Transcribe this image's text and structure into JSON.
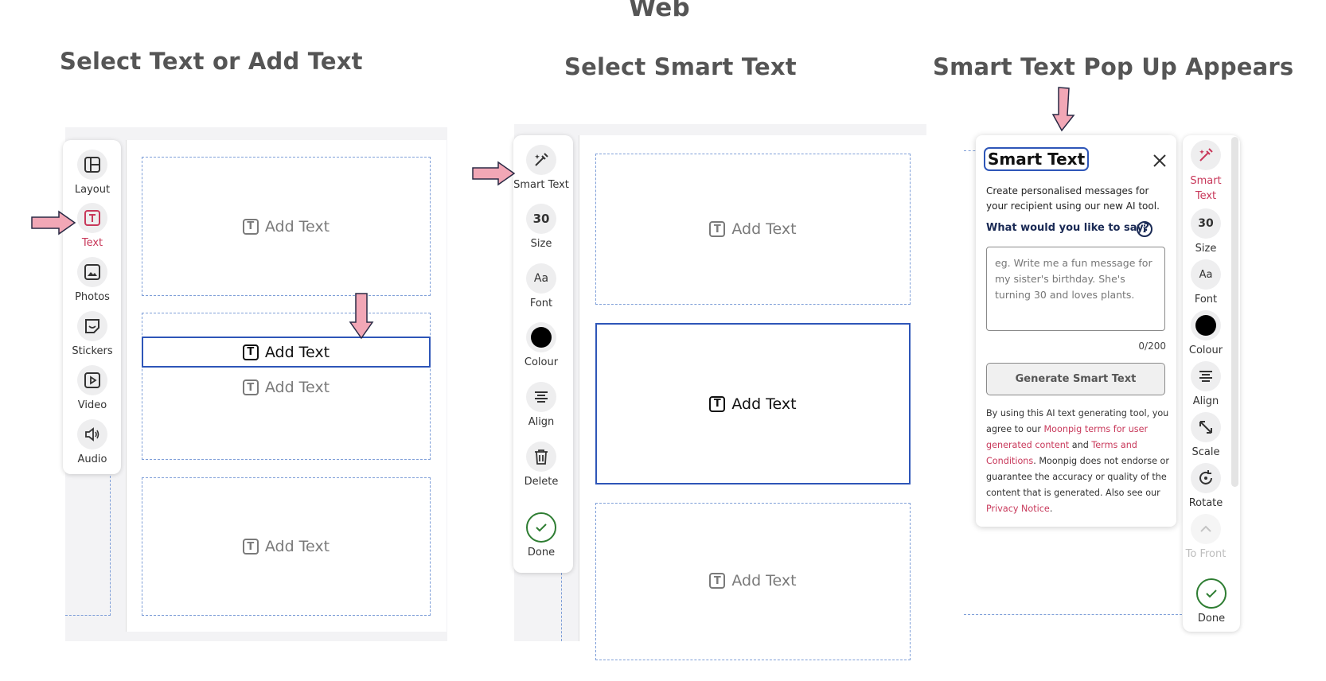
{
  "page_title": "Web",
  "steps": [
    {
      "heading": "Select Text or Add Text"
    },
    {
      "heading": "Select Smart Text"
    },
    {
      "heading": "Smart Text Pop Up Appears"
    }
  ],
  "panel1": {
    "tools": [
      {
        "label": "Layout",
        "icon": "layout-icon"
      },
      {
        "label": "Text",
        "icon": "text-icon",
        "active": true
      },
      {
        "label": "Photos",
        "icon": "photo-icon"
      },
      {
        "label": "Stickers",
        "icon": "sticker-icon"
      },
      {
        "label": "Video",
        "icon": "video-icon"
      },
      {
        "label": "Audio",
        "icon": "audio-icon"
      }
    ],
    "boxes": [
      "Add Text",
      "Add Text",
      "Add Text",
      "Add Text"
    ]
  },
  "panel2": {
    "tools": [
      {
        "label": "Smart Text",
        "icon": "magic-wand-icon"
      },
      {
        "label": "Size",
        "value": "30"
      },
      {
        "label": "Font",
        "glyph": "Aa"
      },
      {
        "label": "Colour",
        "icon": "colour-swatch-icon",
        "color": "#000000"
      },
      {
        "label": "Align",
        "icon": "align-icon"
      },
      {
        "label": "Delete",
        "icon": "trash-icon"
      },
      {
        "label": "Done",
        "icon": "check-icon"
      }
    ],
    "boxes": [
      "Add Text",
      "Add Text",
      "Add Text"
    ]
  },
  "panel3": {
    "popup": {
      "title": "Smart Text",
      "description": "Create personalised messages for your recipient using our new AI tool.",
      "question": "What would you like to say?",
      "placeholder": "eg. Write me a fun message for my sister's birthday. She's turning 30 and loves plants.",
      "counter": "0/200",
      "generate_label": "Generate Smart Text",
      "disclaimer": {
        "part1": "By using this AI text generating tool, you agree to our ",
        "link1": "Moonpig terms for user generated content",
        "part2": " and ",
        "link2": "Terms and Conditions",
        "part3": ". Moonpig does not endorse or guarantee the accuracy or quality of the content that is generated. Also see our ",
        "link3": "Privacy Notice",
        "part4": "."
      }
    },
    "tools": [
      {
        "label": "Smart Text",
        "icon": "magic-wand-icon",
        "active": true
      },
      {
        "label": "Size",
        "value": "30"
      },
      {
        "label": "Font",
        "glyph": "Aa"
      },
      {
        "label": "Colour",
        "icon": "colour-swatch-icon"
      },
      {
        "label": "Align",
        "icon": "align-icon"
      },
      {
        "label": "Scale",
        "icon": "scale-icon"
      },
      {
        "label": "Rotate",
        "icon": "rotate-icon"
      },
      {
        "label": "To Front",
        "icon": "to-front-icon",
        "disabled": true
      },
      {
        "label": "Done",
        "icon": "check-icon"
      }
    ]
  },
  "colors": {
    "accent": "#c8385a",
    "selection": "#2e56b8",
    "arrow": "#f2a7b6",
    "done": "#2e7d32"
  }
}
